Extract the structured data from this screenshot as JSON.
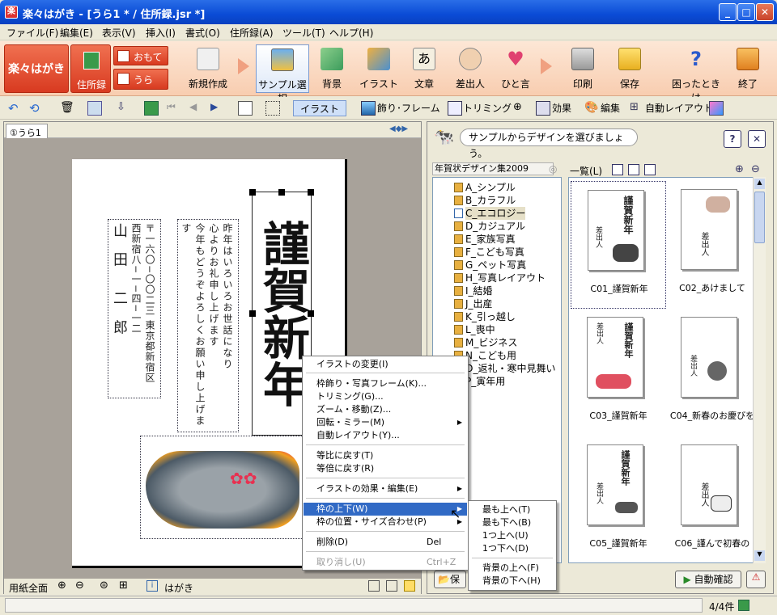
{
  "window": {
    "title": "楽々はがき - [うら1 * / 住所録.jsr *]",
    "min": "_",
    "max": "□",
    "close": "✕"
  },
  "menubar": [
    "ファイル(F)",
    "編集(E)",
    "表示(V)",
    "挿入(I)",
    "書式(O)",
    "住所録(A)",
    "ツール(T)",
    "ヘルプ(H)"
  ],
  "mainbar": {
    "logo": "楽々はがき",
    "address_book": "住所録",
    "omote": "おもて",
    "ura": "うら",
    "buttons": [
      "新規作成",
      "サンプル選択",
      "背景",
      "イラスト",
      "文章",
      "差出人",
      "ひと言",
      "印刷",
      "保存",
      "困ったときは",
      "終了"
    ]
  },
  "toolbar2": {
    "illust": "イラスト",
    "frame": "飾り･フレーム",
    "trim": "トリミング",
    "effect": "効果",
    "edit": "編集",
    "auto": "自動レイアウト"
  },
  "left": {
    "tab": "①うら1",
    "card": {
      "address": "〒一六〇−〇〇二三 東京都新宿区西新宿八−一−四−一二",
      "name": "山 田　二 郎",
      "message_col1": "昨年はいろいろお世話になり",
      "message_col2": "心よりお礼申し上げます",
      "message_col3": "今年もどうぞよろしくお願い申し上げます",
      "title": "謹賀新年"
    },
    "status": {
      "zoom": "用紙全面",
      "paper": "はがき"
    }
  },
  "right": {
    "hint": "サンプルからデザインを選びましょう。",
    "help": "?",
    "close": "✕",
    "set_name": "年賀状デザイン集2009",
    "list_label": "一覧(L)",
    "tree": [
      "A_シンプル",
      "B_カラフル",
      "C_エコロジー",
      "D_カジュアル",
      "E_家族写真",
      "F_こども写真",
      "G_ペット写真",
      "H_写真レイアウト",
      "I_結婚",
      "J_出産",
      "K_引っ越し",
      "L_喪中",
      "M_ビジネス",
      "N_こども用",
      "O_返礼・寒中見舞い",
      "P_寅年用"
    ],
    "thumbs": [
      {
        "cap": "C01_謹賀新年"
      },
      {
        "cap": "C02_あけまして"
      },
      {
        "cap": "C03_謹賀新年"
      },
      {
        "cap": "C04_新春のお慶びを"
      },
      {
        "cap": "C05_謹賀新年"
      },
      {
        "cap": "C06_謹んで初春の"
      }
    ],
    "thumb_text": {
      "sender": "差出人",
      "title": "謹賀新年"
    },
    "auto_check": "自動確認",
    "save_label": "保"
  },
  "status": {
    "count": "4/4件"
  },
  "context_menu": [
    {
      "label": "イラストの変更(I)",
      "type": "item"
    },
    {
      "type": "sep"
    },
    {
      "label": "枠飾り・写真フレーム(K)...",
      "type": "item"
    },
    {
      "label": "トリミング(G)...",
      "type": "item"
    },
    {
      "label": "ズーム・移動(Z)...",
      "type": "item"
    },
    {
      "label": "回転・ミラー(M)",
      "type": "sub"
    },
    {
      "label": "自動レイアウト(Y)...",
      "type": "item"
    },
    {
      "type": "sep"
    },
    {
      "label": "等比に戻す(T)",
      "type": "item"
    },
    {
      "label": "等倍に戻す(R)",
      "type": "item"
    },
    {
      "type": "sep"
    },
    {
      "label": "イラストの効果・編集(E)",
      "type": "sub"
    },
    {
      "type": "sep"
    },
    {
      "label": "枠の上下(W)",
      "type": "sub-hl"
    },
    {
      "label": "枠の位置・サイズ合わせ(P)",
      "type": "sub"
    },
    {
      "type": "sep"
    },
    {
      "label": "削除(D)",
      "type": "item",
      "shortcut": "Del"
    },
    {
      "type": "sep"
    },
    {
      "label": "取り消し(U)",
      "type": "dis",
      "shortcut": "Ctrl+Z"
    }
  ],
  "submenu": [
    "最も上へ(T)",
    "最も下へ(B)",
    "1つ上へ(U)",
    "1つ下へ(D)",
    "背景の上へ(F)",
    "背景の下へ(H)"
  ]
}
